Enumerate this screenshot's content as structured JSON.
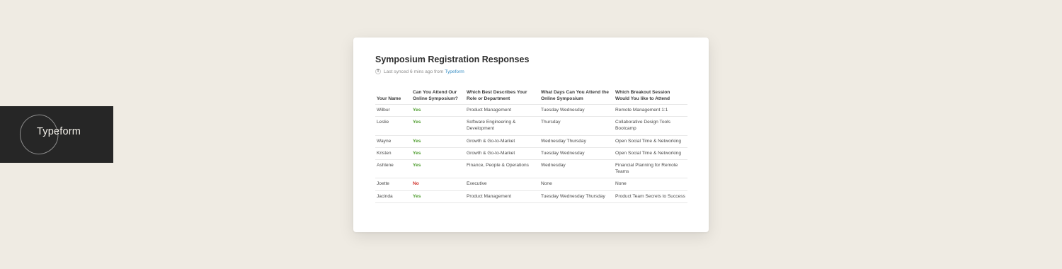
{
  "brand": {
    "wordmark": "Typeform"
  },
  "card": {
    "title": "Symposium Registration Responses",
    "sync": {
      "icon": "typeform-icon",
      "text": "Last synced 6 mins ago from",
      "source": "Typeform"
    }
  },
  "table": {
    "headers": [
      "Your Name",
      "Can You Attend Our Online Symposium?",
      "Which Best Describes Your Role or Department",
      "What Days Can You Attend the Online Symposium",
      "Which Breakout Session Would You like to Attend"
    ],
    "rows": [
      {
        "name": "Wilbur",
        "attend": "Yes",
        "role": "Product Management",
        "days": "Tuesday  Wednesday",
        "session": "Remote Management 1:1"
      },
      {
        "name": "Leslie",
        "attend": "Yes",
        "role": "Software Engineering & Development",
        "days": "Thursday",
        "session": "Collaborative Design Tools Bootcamp"
      },
      {
        "name": "Wayne",
        "attend": "Yes",
        "role": "Growth & Go-to-Market",
        "days": "Wednesday  Thursday",
        "session": "Open Social Time & Networking"
      },
      {
        "name": "Kristen",
        "attend": "Yes",
        "role": "Growth & Go-to-Market",
        "days": "Tuesday  Wednesday",
        "session": "Open Social Time & Networking"
      },
      {
        "name": "Ashlene",
        "attend": "Yes",
        "role": "Finance, People & Operations",
        "days": "Wednesday",
        "session": "Financial Planning for Remote Teams"
      },
      {
        "name": "Joette",
        "attend": "No",
        "role": "Executive",
        "days": "None",
        "session": "None"
      },
      {
        "name": "Jacinda",
        "attend": "Yes",
        "role": "Product Management",
        "days": "Tuesday  Wednesday Thursday",
        "session": "Product Team Secrets to Success"
      }
    ]
  },
  "colors": {
    "background": "#efebe3",
    "brand_tile": "#262626",
    "yes": "#4f9d2f",
    "no": "#d0342c",
    "link": "#3a8fc4"
  }
}
